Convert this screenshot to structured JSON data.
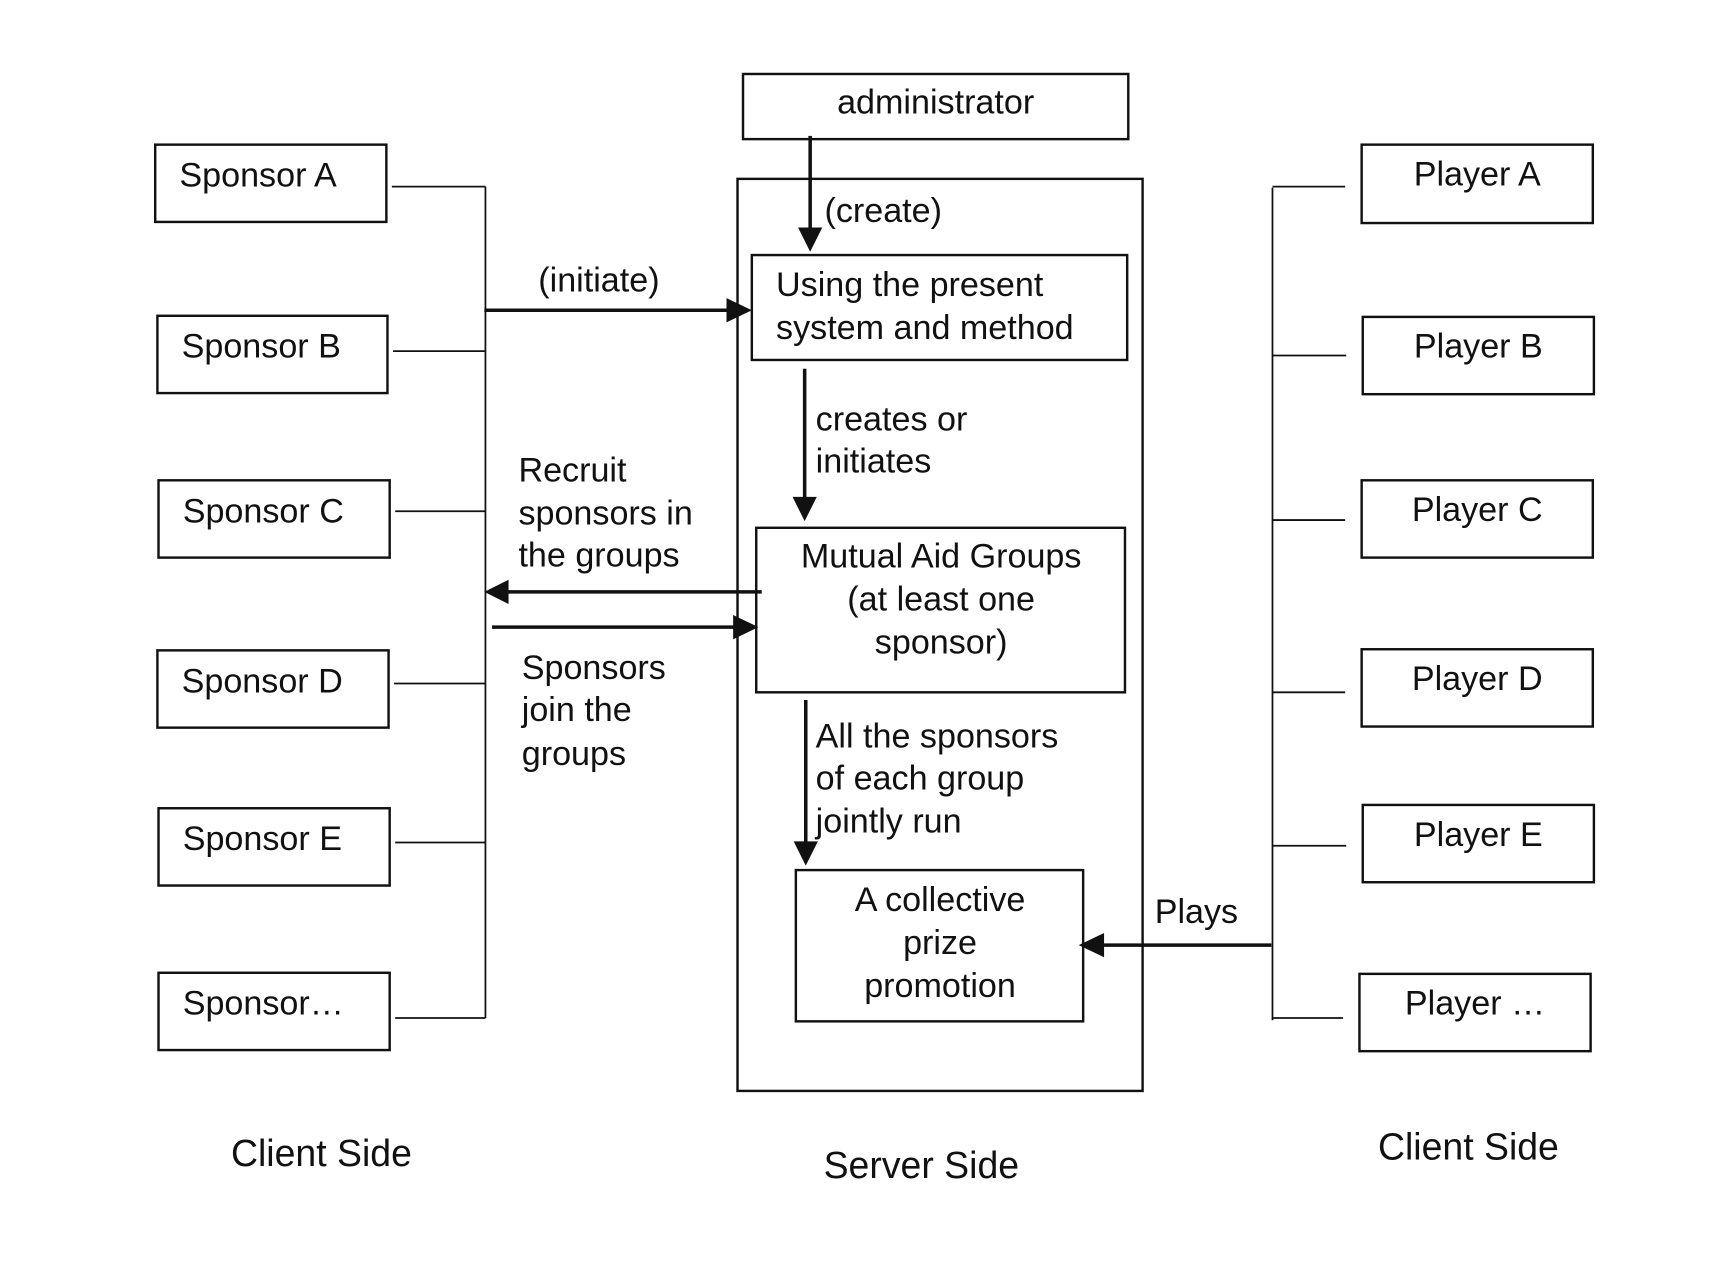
{
  "diagram": {
    "administrator": "administrator",
    "create_label": "(create)",
    "initiate_label": "(initiate)",
    "system_box": [
      "Using the present",
      "system and method"
    ],
    "creates_label": [
      "creates or",
      "initiates"
    ],
    "mutual_aid_box": [
      "Mutual Aid Groups",
      "(at least one",
      "sponsor)"
    ],
    "recruit_label": [
      "Recruit",
      "sponsors in",
      "the groups"
    ],
    "join_label": [
      "Sponsors",
      "join the",
      "groups"
    ],
    "jointly_label": [
      "All the sponsors",
      "of each group",
      "jointly run"
    ],
    "promotion_box": [
      "A collective",
      "prize",
      "promotion"
    ],
    "plays_label": "Plays",
    "sponsors": [
      "Sponsor A",
      "Sponsor B",
      "Sponsor C",
      "Sponsor D",
      "Sponsor E",
      "Sponsor…"
    ],
    "players": [
      "Player A",
      "Player B",
      "Player C",
      "Player D",
      "Player E",
      "Player …"
    ],
    "footer": {
      "left": "Client Side",
      "center": "Server Side",
      "right": "Client Side"
    }
  }
}
